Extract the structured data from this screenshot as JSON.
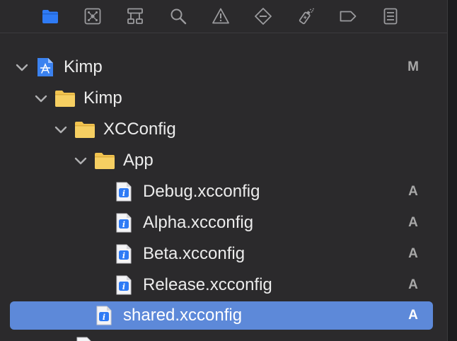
{
  "toolbar": {
    "icons": [
      {
        "name": "folder-icon",
        "active": true
      },
      {
        "name": "source-control-icon"
      },
      {
        "name": "hierarchy-icon"
      },
      {
        "name": "search-icon"
      },
      {
        "name": "warning-icon"
      },
      {
        "name": "test-icon"
      },
      {
        "name": "debug-icon"
      },
      {
        "name": "breakpoint-icon"
      },
      {
        "name": "report-icon"
      }
    ]
  },
  "tree": {
    "project": {
      "label": "Kimp",
      "status": "M"
    },
    "group_kimp": {
      "label": "Kimp"
    },
    "group_xcconfig": {
      "label": "XCConfig"
    },
    "group_app": {
      "label": "App"
    },
    "files": [
      {
        "label": "Debug.xcconfig",
        "status": "A"
      },
      {
        "label": "Alpha.xcconfig",
        "status": "A"
      },
      {
        "label": "Beta.xcconfig",
        "status": "A"
      },
      {
        "label": "Release.xcconfig",
        "status": "A"
      }
    ],
    "shared": {
      "label": "shared.xcconfig",
      "status": "A"
    }
  },
  "colors": {
    "background": "#2b2a2c",
    "accent": "#2f7bf5",
    "selection": "#5d89d9",
    "folder": "#f1c34f",
    "icon_gray": "#9b9b9e"
  }
}
